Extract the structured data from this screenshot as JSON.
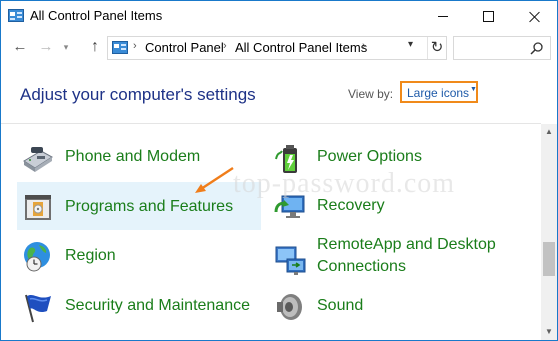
{
  "window": {
    "title": "All Control Panel Items",
    "accent_color": "#1979ca"
  },
  "nav": {
    "back_icon": "arrow-left-icon",
    "forward_icon": "arrow-right-icon",
    "recent_icon": "chevron-down-icon",
    "up_icon": "arrow-up-icon",
    "breadcrumb": [
      "Control Panel",
      "All Control Panel Items"
    ],
    "breadcrumb_sep": "›",
    "address_dropdown_icon": "chevron-down-icon",
    "refresh_icon": "refresh-icon",
    "search_placeholder": "",
    "search_icon": "search-icon"
  },
  "header": {
    "title": "Adjust your computer's settings",
    "view_by_label": "View by:",
    "view_by_value": "Large icons",
    "highlight_color": "#f08a1a"
  },
  "watermark": "top-password.com",
  "items": [
    {
      "label": "Phone and Modem",
      "icon": "phone-modem-icon"
    },
    {
      "label": "Power Options",
      "icon": "battery-icon"
    },
    {
      "label": "Programs and Features",
      "icon": "programs-box-icon",
      "selected": true
    },
    {
      "label": "Recovery",
      "icon": "recovery-monitor-icon"
    },
    {
      "label": "Region",
      "icon": "globe-clock-icon"
    },
    {
      "label": "RemoteApp and Desktop Connections",
      "label_line1": "RemoteApp and Desktop",
      "label_line2": "Connections",
      "icon": "remote-desktop-icon"
    },
    {
      "label": "Security and Maintenance",
      "icon": "flag-icon"
    },
    {
      "label": "Sound",
      "icon": "speaker-icon"
    }
  ],
  "annotation": {
    "arrow_color": "#f07d1a",
    "points_to": "Programs and Features"
  },
  "colors": {
    "item_text": "#1a7d1a",
    "title_text": "#1e3287",
    "selected_bg": "#e5f3fb"
  }
}
